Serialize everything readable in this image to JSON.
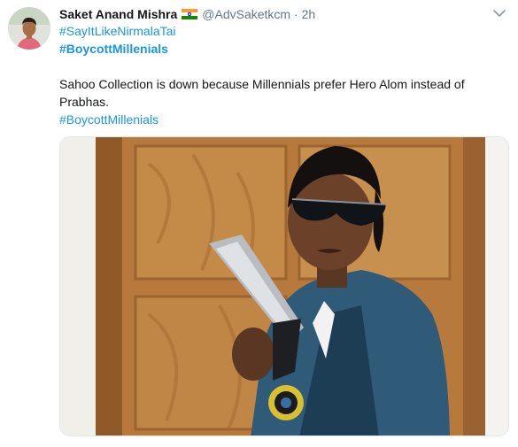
{
  "tweet": {
    "author_name": "Saket Anand Mishra",
    "flag_icon": "india-flag-icon",
    "handle": "@AdvSaketkcm",
    "separator": "·",
    "timestamp": "2h",
    "hashtag_1": "#SayItLikeNirmalaTai",
    "hashtag_2": "#BoycottMillenials",
    "text": "Sahoo Collection is down because Millennials prefer Hero Alom instead of Prabhas.",
    "hashtag_3": "#BoycottMillenials",
    "more_icon": "chevron-down-icon",
    "media_description": "photo-of-man-with-sunglasses-and-pistol"
  },
  "colors": {
    "link": "#1b95e0",
    "secondary_text": "#657786",
    "primary_text": "#14171a",
    "border": "#e1e8ed"
  }
}
